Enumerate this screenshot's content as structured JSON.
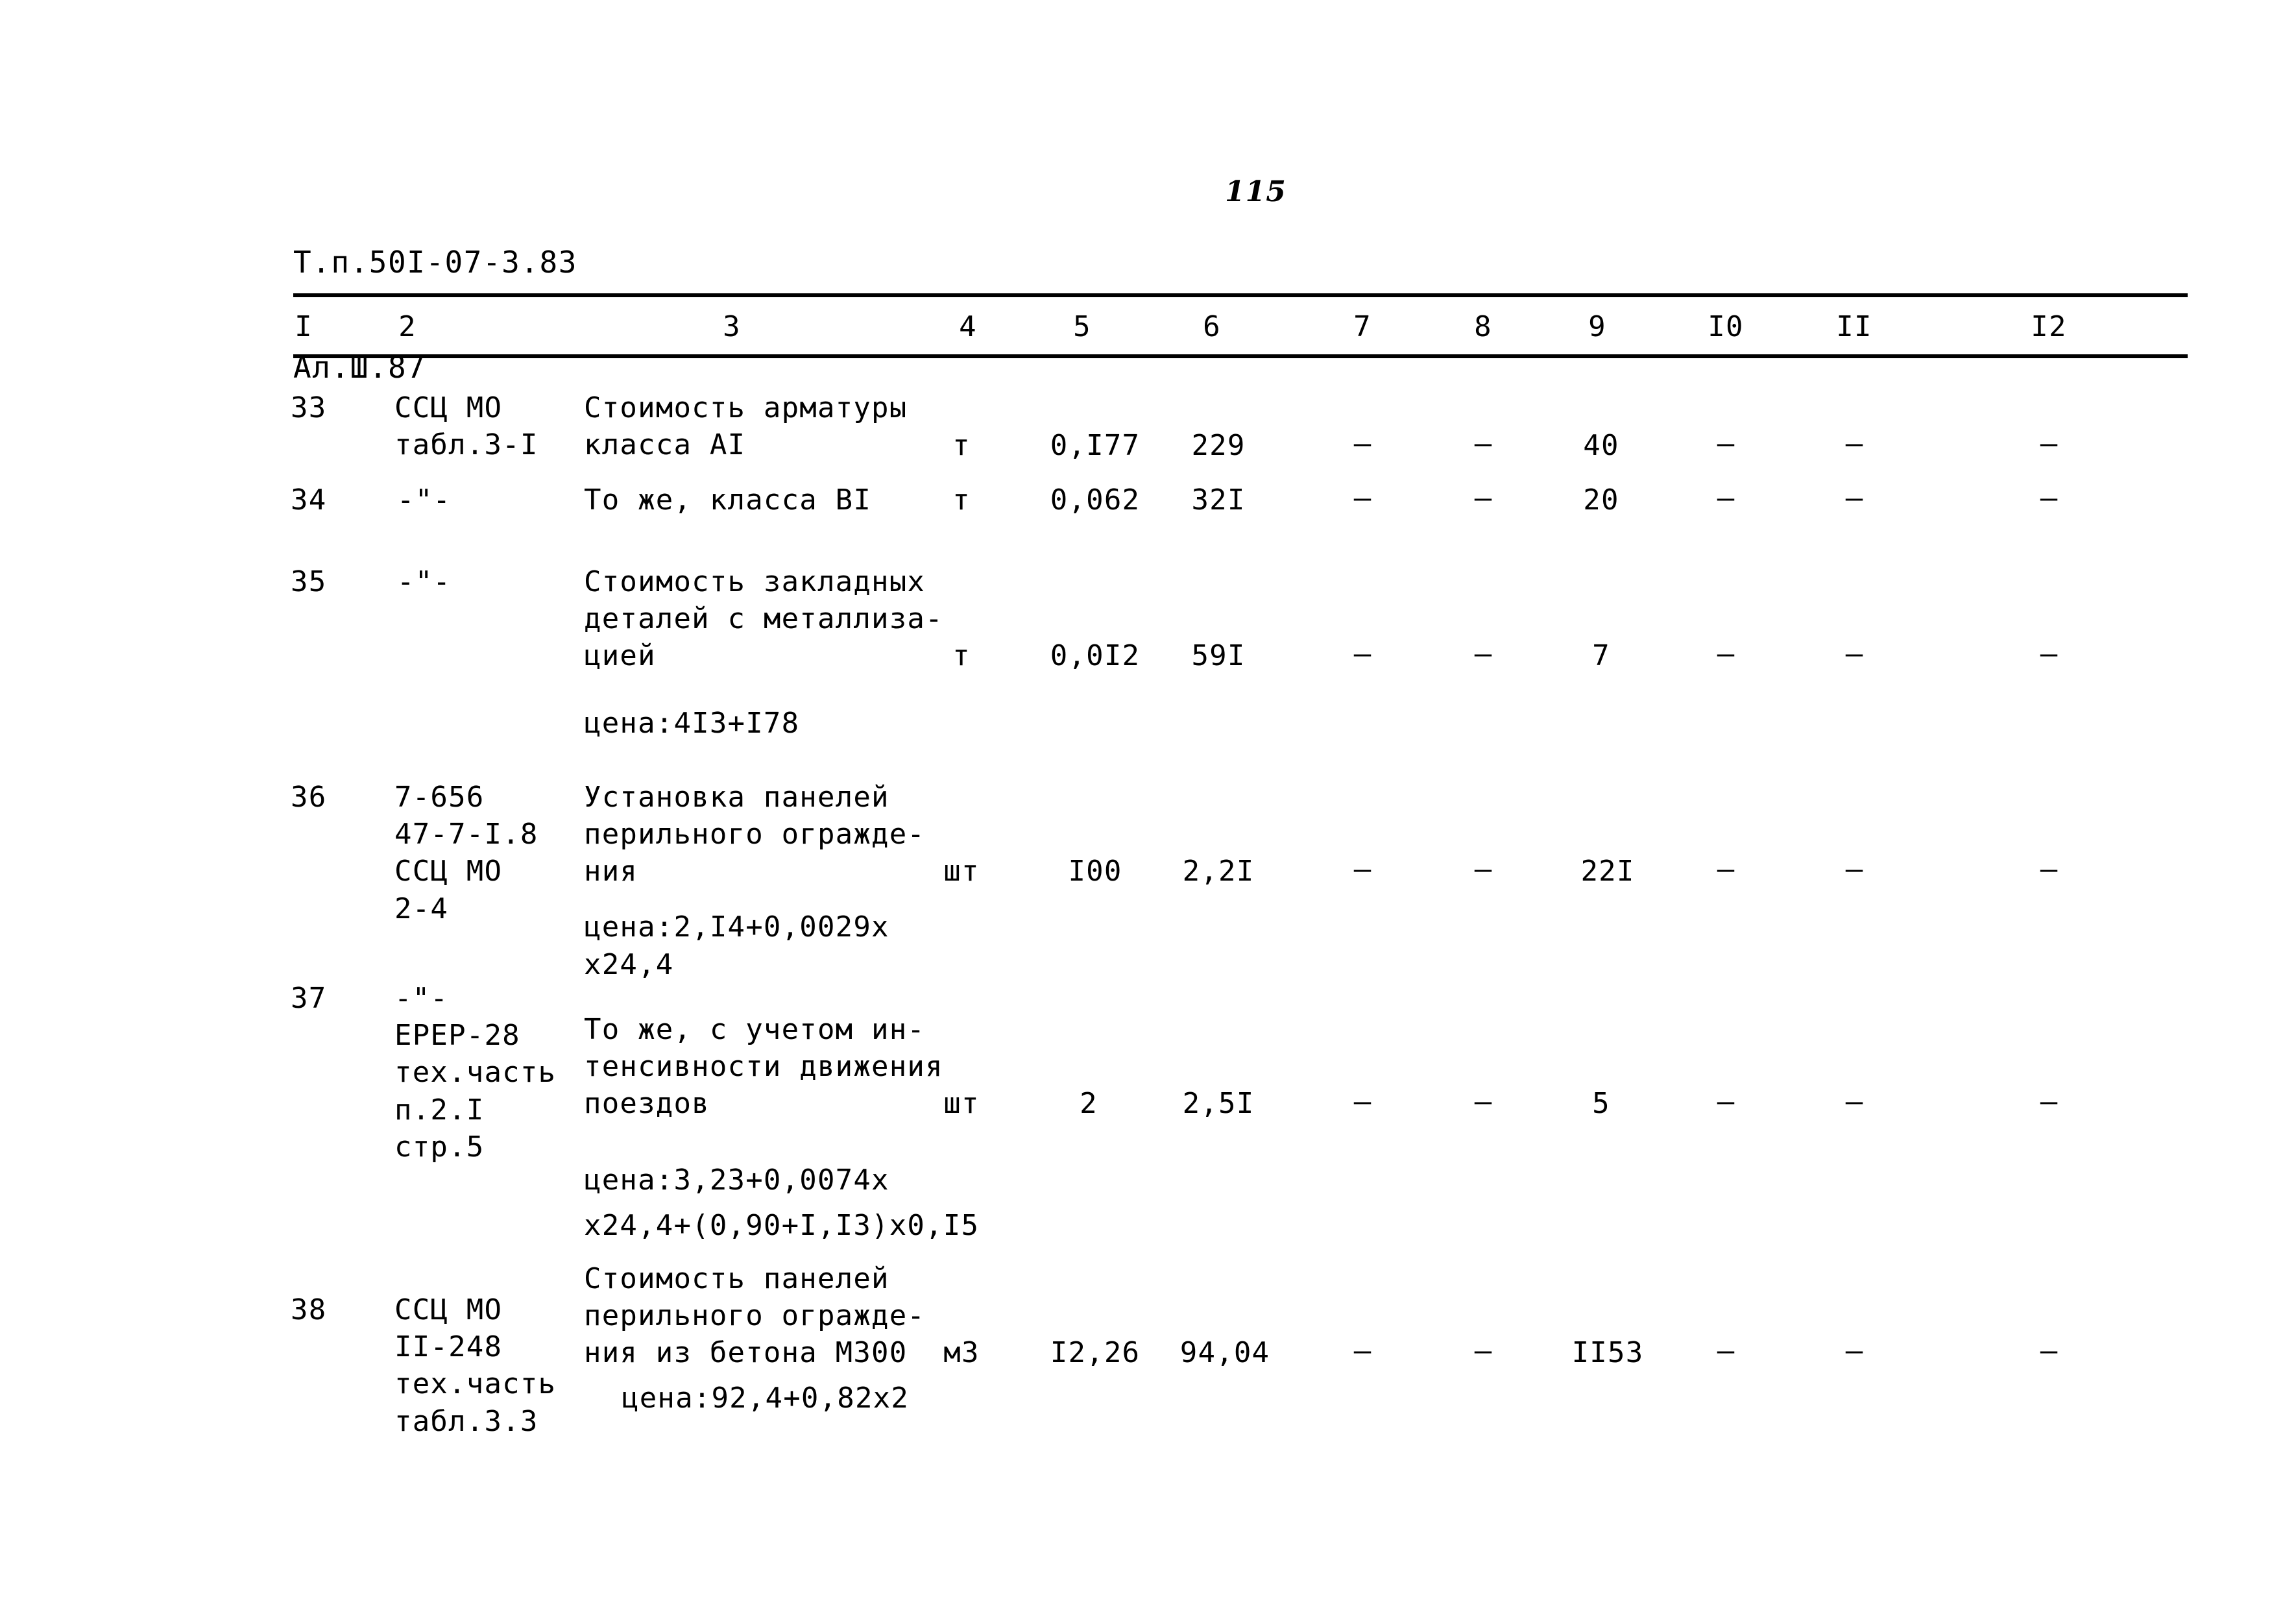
{
  "document": {
    "header_lines": [
      "Т.п.50I-07-3.83",
      "Ал.Ш.87"
    ],
    "page_number": "115"
  },
  "table": {
    "column_headers": [
      "I",
      "2",
      "3",
      "4",
      "5",
      "6",
      "7",
      "8",
      "9",
      "I0",
      "II",
      "I2"
    ],
    "dash": "–",
    "rows": [
      {
        "num": "33",
        "code": "ССЦ МО\nтабл.3-I",
        "description": "Стоимость арматуры\nкласса АI",
        "unit": "т",
        "qty": "0,I77",
        "price": "229",
        "c7": "–",
        "c8": "–",
        "c9": "40",
        "c10": "–",
        "c11": "–",
        "c12": "–",
        "note": ""
      },
      {
        "num": "34",
        "code": "-\"-",
        "description": "То же, класса ВI",
        "unit": "т",
        "qty": "0,062",
        "price": "32I",
        "c7": "–",
        "c8": "–",
        "c9": "20",
        "c10": "–",
        "c11": "–",
        "c12": "–",
        "note": ""
      },
      {
        "num": "35",
        "code": "-\"-",
        "description": "Стоимость закладных\nдеталей с металлиза-\nцией",
        "unit": "т",
        "qty": "0,0I2",
        "price": "59I",
        "c7": "–",
        "c8": "–",
        "c9": "7",
        "c10": "–",
        "c11": "–",
        "c12": "–",
        "note": "цена:4I3+I78"
      },
      {
        "num": "36",
        "code": "7-656\n47-7-I.8\nССЦ МО\n2-4",
        "description": "Установка панелей\nперильного огражде-\nния",
        "unit": "шт",
        "qty": "I00",
        "price": "2,2I",
        "c7": "–",
        "c8": "–",
        "c9": "22I",
        "c10": "–",
        "c11": "–",
        "c12": "–",
        "note": "цена:2,I4+0,0029х\nх24,4"
      },
      {
        "num": "37",
        "code": "-\"-\nЕРЕР-28\nтех.часть\nп.2.I\nстр.5",
        "description": "То же, с учетом ин-\nтенсивности движения\nпоездов",
        "unit": "шт",
        "qty": "2",
        "price": "2,5I",
        "c7": "–",
        "c8": "–",
        "c9": "5",
        "c10": "–",
        "c11": "–",
        "c12": "–",
        "note": "цена:3,23+0,0074х",
        "note2": "х24,4+(0,90+I,I3)х0,I5"
      },
      {
        "num": "38",
        "code": "ССЦ МО\nII-248\nтех.часть\nтабл.3.3",
        "description": "Стоимость панелей\nперильного огражде-\nния из бетона М300",
        "unit": "м3",
        "qty": "I2,26",
        "price": "94,04",
        "c7": "–",
        "c8": "–",
        "c9": "II53",
        "c10": "–",
        "c11": "–",
        "c12": "–",
        "note": "цена:92,4+0,82х2"
      }
    ]
  }
}
